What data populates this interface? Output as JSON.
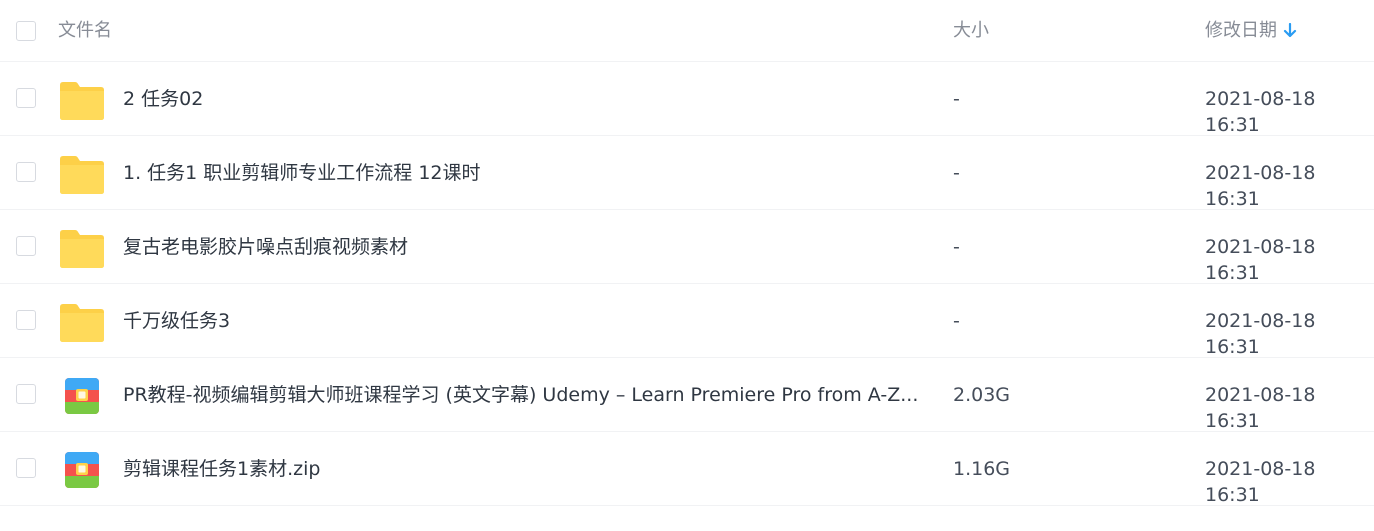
{
  "header": {
    "name_label": "文件名",
    "size_label": "大小",
    "date_label": "修改日期",
    "sort_icon": "arrow-down-icon",
    "accent_color": "#2a9cf2"
  },
  "files": [
    {
      "type": "folder",
      "icon": "folder-icon",
      "name": "2 任务02",
      "size": "-",
      "date": "2021-08-18 16:31"
    },
    {
      "type": "folder",
      "icon": "folder-icon",
      "name": "1. 任务1 职业剪辑师专业工作流程 12课时",
      "size": "-",
      "date": "2021-08-18 16:31"
    },
    {
      "type": "folder",
      "icon": "folder-icon",
      "name": "复古老电影胶片噪点刮痕视频素材",
      "size": "-",
      "date": "2021-08-18 16:31"
    },
    {
      "type": "folder",
      "icon": "folder-icon",
      "name": "千万级任务3",
      "size": "-",
      "date": "2021-08-18 16:31"
    },
    {
      "type": "archive",
      "icon": "archive-icon",
      "name": "PR教程-视频编辑剪辑大师班课程学习 (英文字幕) Udemy – Learn Premiere Pro from A-Z...",
      "size": "2.03G",
      "date": "2021-08-18 16:31"
    },
    {
      "type": "archive",
      "icon": "archive-icon",
      "name": "剪辑课程任务1素材.zip",
      "size": "1.16G",
      "date": "2021-08-18 16:31"
    }
  ]
}
